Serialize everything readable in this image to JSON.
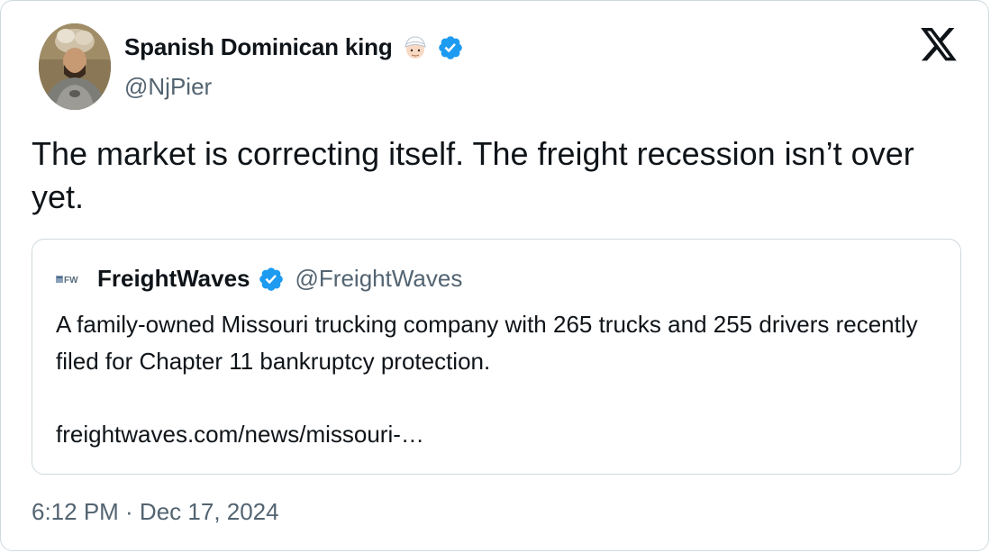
{
  "author": {
    "display_name": "Spanish Dominican king",
    "handle": "@NjPier",
    "avatar_icon": "armored-man-portrait",
    "emoji_icon": "man-with-turban-emoji",
    "verified_icon": "verified-badge-icon"
  },
  "tweet": {
    "text": "The market is correcting itself. The freight recession isn’t over yet.",
    "timestamp": "6:12 PM · Dec 17, 2024"
  },
  "quote": {
    "logo_icon": "freightwaves-logo",
    "display_name": "FreightWaves",
    "handle": "@FreightWaves",
    "text": "A family-owned Missouri trucking company with 265 trucks and 255 drivers recently filed for Chapter 11 bankruptcy protection.",
    "link": "freightwaves.com/news/missouri-…"
  },
  "colors": {
    "verified_blue": "#1d9bf0",
    "secondary_text": "#536471",
    "border": "#cfd9de",
    "primary_text": "#0f1419"
  }
}
